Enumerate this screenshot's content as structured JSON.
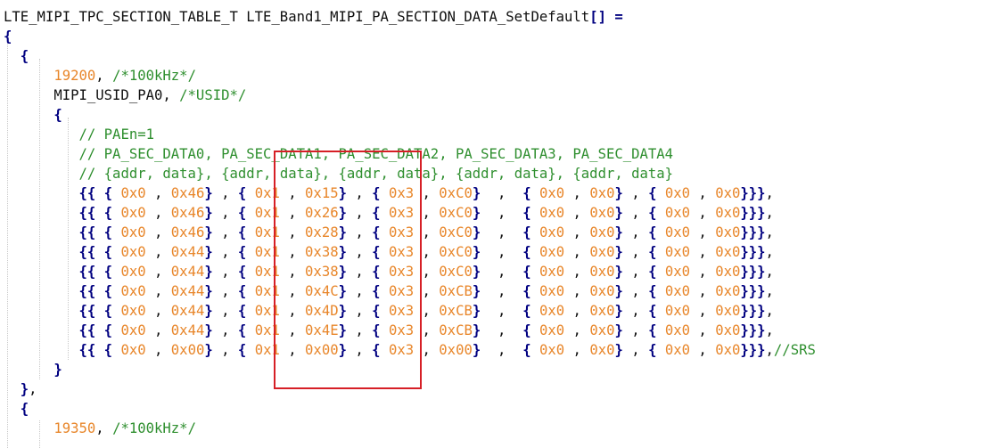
{
  "colors": {
    "background": "#ffffff",
    "text": "#101010",
    "brace": "#000080",
    "number": "#e8862a",
    "comment": "#2f8f2f",
    "highlight": "#d61f26"
  },
  "code": {
    "lines": [
      [
        [
          "def",
          "LTE_MIPI_TPC_SECTION_TABLE_T LTE_Band1_MIPI_PA_SECTION_DATA_SetDefault"
        ],
        [
          "br",
          "[]"
        ],
        [
          "def",
          " "
        ],
        [
          "br",
          "="
        ]
      ],
      [
        [
          "br",
          "{"
        ]
      ],
      [
        [
          "def",
          "  "
        ],
        [
          "br",
          "{"
        ]
      ],
      [
        [
          "def",
          "      "
        ],
        [
          "num",
          "19200"
        ],
        [
          "def",
          ", "
        ],
        [
          "com",
          "/*100kHz*/"
        ]
      ],
      [
        [
          "def",
          "      MIPI_USID_PA0, "
        ],
        [
          "com",
          "/*USID*/"
        ]
      ],
      [
        [
          "def",
          "      "
        ],
        [
          "br",
          "{"
        ]
      ],
      [
        [
          "def",
          "         "
        ],
        [
          "com",
          "// PAEn=1"
        ]
      ],
      [
        [
          "def",
          "         "
        ],
        [
          "com",
          "// PA_SEC_DATA0, PA_SEC_DATA1, PA_SEC_DATA2, PA_SEC_DATA3, PA_SEC_DATA4"
        ]
      ],
      [
        [
          "def",
          "         "
        ],
        [
          "com",
          "// {addr, data}, {addr, data}, {addr, data}, {addr, data}, {addr, data}"
        ]
      ],
      [
        [
          "def",
          "         "
        ],
        [
          "br",
          "{{ {"
        ],
        [
          "def",
          " "
        ],
        [
          "num",
          "0x0"
        ],
        [
          "def",
          " , "
        ],
        [
          "num",
          "0x46"
        ],
        [
          "br",
          "}"
        ],
        [
          "def",
          " , "
        ],
        [
          "br",
          "{"
        ],
        [
          "def",
          " "
        ],
        [
          "num",
          "0x1"
        ],
        [
          "def",
          " , "
        ],
        [
          "num",
          "0x15"
        ],
        [
          "br",
          "}"
        ],
        [
          "def",
          " , "
        ],
        [
          "br",
          "{"
        ],
        [
          "def",
          " "
        ],
        [
          "num",
          "0x3"
        ],
        [
          "def",
          " , "
        ],
        [
          "num",
          "0xC0"
        ],
        [
          "br",
          "}"
        ],
        [
          "def",
          "  ,  "
        ],
        [
          "br",
          "{"
        ],
        [
          "def",
          " "
        ],
        [
          "num",
          "0x0"
        ],
        [
          "def",
          " , "
        ],
        [
          "num",
          "0x0"
        ],
        [
          "br",
          "}"
        ],
        [
          "def",
          " , "
        ],
        [
          "br",
          "{"
        ],
        [
          "def",
          " "
        ],
        [
          "num",
          "0x0"
        ],
        [
          "def",
          " , "
        ],
        [
          "num",
          "0x0"
        ],
        [
          "br",
          "}}}"
        ],
        [
          "def",
          ","
        ]
      ],
      [
        [
          "def",
          "         "
        ],
        [
          "br",
          "{{ {"
        ],
        [
          "def",
          " "
        ],
        [
          "num",
          "0x0"
        ],
        [
          "def",
          " , "
        ],
        [
          "num",
          "0x46"
        ],
        [
          "br",
          "}"
        ],
        [
          "def",
          " , "
        ],
        [
          "br",
          "{"
        ],
        [
          "def",
          " "
        ],
        [
          "num",
          "0x1"
        ],
        [
          "def",
          " , "
        ],
        [
          "num",
          "0x26"
        ],
        [
          "br",
          "}"
        ],
        [
          "def",
          " , "
        ],
        [
          "br",
          "{"
        ],
        [
          "def",
          " "
        ],
        [
          "num",
          "0x3"
        ],
        [
          "def",
          " , "
        ],
        [
          "num",
          "0xC0"
        ],
        [
          "br",
          "}"
        ],
        [
          "def",
          "  ,  "
        ],
        [
          "br",
          "{"
        ],
        [
          "def",
          " "
        ],
        [
          "num",
          "0x0"
        ],
        [
          "def",
          " , "
        ],
        [
          "num",
          "0x0"
        ],
        [
          "br",
          "}"
        ],
        [
          "def",
          " , "
        ],
        [
          "br",
          "{"
        ],
        [
          "def",
          " "
        ],
        [
          "num",
          "0x0"
        ],
        [
          "def",
          " , "
        ],
        [
          "num",
          "0x0"
        ],
        [
          "br",
          "}}}"
        ],
        [
          "def",
          ","
        ]
      ],
      [
        [
          "def",
          "         "
        ],
        [
          "br",
          "{{ {"
        ],
        [
          "def",
          " "
        ],
        [
          "num",
          "0x0"
        ],
        [
          "def",
          " , "
        ],
        [
          "num",
          "0x46"
        ],
        [
          "br",
          "}"
        ],
        [
          "def",
          " , "
        ],
        [
          "br",
          "{"
        ],
        [
          "def",
          " "
        ],
        [
          "num",
          "0x1"
        ],
        [
          "def",
          " , "
        ],
        [
          "num",
          "0x28"
        ],
        [
          "br",
          "}"
        ],
        [
          "def",
          " , "
        ],
        [
          "br",
          "{"
        ],
        [
          "def",
          " "
        ],
        [
          "num",
          "0x3"
        ],
        [
          "def",
          " , "
        ],
        [
          "num",
          "0xC0"
        ],
        [
          "br",
          "}"
        ],
        [
          "def",
          "  ,  "
        ],
        [
          "br",
          "{"
        ],
        [
          "def",
          " "
        ],
        [
          "num",
          "0x0"
        ],
        [
          "def",
          " , "
        ],
        [
          "num",
          "0x0"
        ],
        [
          "br",
          "}"
        ],
        [
          "def",
          " , "
        ],
        [
          "br",
          "{"
        ],
        [
          "def",
          " "
        ],
        [
          "num",
          "0x0"
        ],
        [
          "def",
          " , "
        ],
        [
          "num",
          "0x0"
        ],
        [
          "br",
          "}}}"
        ],
        [
          "def",
          ","
        ]
      ],
      [
        [
          "def",
          "         "
        ],
        [
          "br",
          "{{ {"
        ],
        [
          "def",
          " "
        ],
        [
          "num",
          "0x0"
        ],
        [
          "def",
          " , "
        ],
        [
          "num",
          "0x44"
        ],
        [
          "br",
          "}"
        ],
        [
          "def",
          " , "
        ],
        [
          "br",
          "{"
        ],
        [
          "def",
          " "
        ],
        [
          "num",
          "0x1"
        ],
        [
          "def",
          " , "
        ],
        [
          "num",
          "0x38"
        ],
        [
          "br",
          "}"
        ],
        [
          "def",
          " , "
        ],
        [
          "br",
          "{"
        ],
        [
          "def",
          " "
        ],
        [
          "num",
          "0x3"
        ],
        [
          "def",
          " , "
        ],
        [
          "num",
          "0xC0"
        ],
        [
          "br",
          "}"
        ],
        [
          "def",
          "  ,  "
        ],
        [
          "br",
          "{"
        ],
        [
          "def",
          " "
        ],
        [
          "num",
          "0x0"
        ],
        [
          "def",
          " , "
        ],
        [
          "num",
          "0x0"
        ],
        [
          "br",
          "}"
        ],
        [
          "def",
          " , "
        ],
        [
          "br",
          "{"
        ],
        [
          "def",
          " "
        ],
        [
          "num",
          "0x0"
        ],
        [
          "def",
          " , "
        ],
        [
          "num",
          "0x0"
        ],
        [
          "br",
          "}}}"
        ],
        [
          "def",
          ","
        ]
      ],
      [
        [
          "def",
          "         "
        ],
        [
          "br",
          "{{ {"
        ],
        [
          "def",
          " "
        ],
        [
          "num",
          "0x0"
        ],
        [
          "def",
          " , "
        ],
        [
          "num",
          "0x44"
        ],
        [
          "br",
          "}"
        ],
        [
          "def",
          " , "
        ],
        [
          "br",
          "{"
        ],
        [
          "def",
          " "
        ],
        [
          "num",
          "0x1"
        ],
        [
          "def",
          " , "
        ],
        [
          "num",
          "0x38"
        ],
        [
          "br",
          "}"
        ],
        [
          "def",
          " , "
        ],
        [
          "br",
          "{"
        ],
        [
          "def",
          " "
        ],
        [
          "num",
          "0x3"
        ],
        [
          "def",
          " , "
        ],
        [
          "num",
          "0xC0"
        ],
        [
          "br",
          "}"
        ],
        [
          "def",
          "  ,  "
        ],
        [
          "br",
          "{"
        ],
        [
          "def",
          " "
        ],
        [
          "num",
          "0x0"
        ],
        [
          "def",
          " , "
        ],
        [
          "num",
          "0x0"
        ],
        [
          "br",
          "}"
        ],
        [
          "def",
          " , "
        ],
        [
          "br",
          "{"
        ],
        [
          "def",
          " "
        ],
        [
          "num",
          "0x0"
        ],
        [
          "def",
          " , "
        ],
        [
          "num",
          "0x0"
        ],
        [
          "br",
          "}}}"
        ],
        [
          "def",
          ","
        ]
      ],
      [
        [
          "def",
          "         "
        ],
        [
          "br",
          "{{ {"
        ],
        [
          "def",
          " "
        ],
        [
          "num",
          "0x0"
        ],
        [
          "def",
          " , "
        ],
        [
          "num",
          "0x44"
        ],
        [
          "br",
          "}"
        ],
        [
          "def",
          " , "
        ],
        [
          "br",
          "{"
        ],
        [
          "def",
          " "
        ],
        [
          "num",
          "0x1"
        ],
        [
          "def",
          " , "
        ],
        [
          "num",
          "0x4C"
        ],
        [
          "br",
          "}"
        ],
        [
          "def",
          " , "
        ],
        [
          "br",
          "{"
        ],
        [
          "def",
          " "
        ],
        [
          "num",
          "0x3"
        ],
        [
          "def",
          " , "
        ],
        [
          "num",
          "0xCB"
        ],
        [
          "br",
          "}"
        ],
        [
          "def",
          "  ,  "
        ],
        [
          "br",
          "{"
        ],
        [
          "def",
          " "
        ],
        [
          "num",
          "0x0"
        ],
        [
          "def",
          " , "
        ],
        [
          "num",
          "0x0"
        ],
        [
          "br",
          "}"
        ],
        [
          "def",
          " , "
        ],
        [
          "br",
          "{"
        ],
        [
          "def",
          " "
        ],
        [
          "num",
          "0x0"
        ],
        [
          "def",
          " , "
        ],
        [
          "num",
          "0x0"
        ],
        [
          "br",
          "}}}"
        ],
        [
          "def",
          ","
        ]
      ],
      [
        [
          "def",
          "         "
        ],
        [
          "br",
          "{{ {"
        ],
        [
          "def",
          " "
        ],
        [
          "num",
          "0x0"
        ],
        [
          "def",
          " , "
        ],
        [
          "num",
          "0x44"
        ],
        [
          "br",
          "}"
        ],
        [
          "def",
          " , "
        ],
        [
          "br",
          "{"
        ],
        [
          "def",
          " "
        ],
        [
          "num",
          "0x1"
        ],
        [
          "def",
          " , "
        ],
        [
          "num",
          "0x4D"
        ],
        [
          "br",
          "}"
        ],
        [
          "def",
          " , "
        ],
        [
          "br",
          "{"
        ],
        [
          "def",
          " "
        ],
        [
          "num",
          "0x3"
        ],
        [
          "def",
          " , "
        ],
        [
          "num",
          "0xCB"
        ],
        [
          "br",
          "}"
        ],
        [
          "def",
          "  ,  "
        ],
        [
          "br",
          "{"
        ],
        [
          "def",
          " "
        ],
        [
          "num",
          "0x0"
        ],
        [
          "def",
          " , "
        ],
        [
          "num",
          "0x0"
        ],
        [
          "br",
          "}"
        ],
        [
          "def",
          " , "
        ],
        [
          "br",
          "{"
        ],
        [
          "def",
          " "
        ],
        [
          "num",
          "0x0"
        ],
        [
          "def",
          " , "
        ],
        [
          "num",
          "0x0"
        ],
        [
          "br",
          "}}}"
        ],
        [
          "def",
          ","
        ]
      ],
      [
        [
          "def",
          "         "
        ],
        [
          "br",
          "{{ {"
        ],
        [
          "def",
          " "
        ],
        [
          "num",
          "0x0"
        ],
        [
          "def",
          " , "
        ],
        [
          "num",
          "0x44"
        ],
        [
          "br",
          "}"
        ],
        [
          "def",
          " , "
        ],
        [
          "br",
          "{"
        ],
        [
          "def",
          " "
        ],
        [
          "num",
          "0x1"
        ],
        [
          "def",
          " , "
        ],
        [
          "num",
          "0x4E"
        ],
        [
          "br",
          "}"
        ],
        [
          "def",
          " , "
        ],
        [
          "br",
          "{"
        ],
        [
          "def",
          " "
        ],
        [
          "num",
          "0x3"
        ],
        [
          "def",
          " , "
        ],
        [
          "num",
          "0xCB"
        ],
        [
          "br",
          "}"
        ],
        [
          "def",
          "  ,  "
        ],
        [
          "br",
          "{"
        ],
        [
          "def",
          " "
        ],
        [
          "num",
          "0x0"
        ],
        [
          "def",
          " , "
        ],
        [
          "num",
          "0x0"
        ],
        [
          "br",
          "}"
        ],
        [
          "def",
          " , "
        ],
        [
          "br",
          "{"
        ],
        [
          "def",
          " "
        ],
        [
          "num",
          "0x0"
        ],
        [
          "def",
          " , "
        ],
        [
          "num",
          "0x0"
        ],
        [
          "br",
          "}}}"
        ],
        [
          "def",
          ","
        ]
      ],
      [
        [
          "def",
          "         "
        ],
        [
          "br",
          "{{ {"
        ],
        [
          "def",
          " "
        ],
        [
          "num",
          "0x0"
        ],
        [
          "def",
          " , "
        ],
        [
          "num",
          "0x00"
        ],
        [
          "br",
          "}"
        ],
        [
          "def",
          " , "
        ],
        [
          "br",
          "{"
        ],
        [
          "def",
          " "
        ],
        [
          "num",
          "0x1"
        ],
        [
          "def",
          " , "
        ],
        [
          "num",
          "0x00"
        ],
        [
          "br",
          "}"
        ],
        [
          "def",
          " , "
        ],
        [
          "br",
          "{"
        ],
        [
          "def",
          " "
        ],
        [
          "num",
          "0x3"
        ],
        [
          "def",
          " , "
        ],
        [
          "num",
          "0x00"
        ],
        [
          "br",
          "}"
        ],
        [
          "def",
          "  ,  "
        ],
        [
          "br",
          "{"
        ],
        [
          "def",
          " "
        ],
        [
          "num",
          "0x0"
        ],
        [
          "def",
          " , "
        ],
        [
          "num",
          "0x0"
        ],
        [
          "br",
          "}"
        ],
        [
          "def",
          " , "
        ],
        [
          "br",
          "{"
        ],
        [
          "def",
          " "
        ],
        [
          "num",
          "0x0"
        ],
        [
          "def",
          " , "
        ],
        [
          "num",
          "0x0"
        ],
        [
          "br",
          "}}}"
        ],
        [
          "def",
          ","
        ],
        [
          "com",
          "//SRS"
        ]
      ],
      [
        [
          "def",
          "      "
        ],
        [
          "br",
          "}"
        ]
      ],
      [
        [
          "def",
          "  "
        ],
        [
          "br",
          "}"
        ],
        [
          "def",
          ","
        ]
      ],
      [
        [
          "def",
          "  "
        ],
        [
          "br",
          "{"
        ]
      ],
      [
        [
          "def",
          "      "
        ],
        [
          "num",
          "19350"
        ],
        [
          "def",
          ", "
        ],
        [
          "com",
          "/*100kHz*/"
        ]
      ]
    ]
  }
}
